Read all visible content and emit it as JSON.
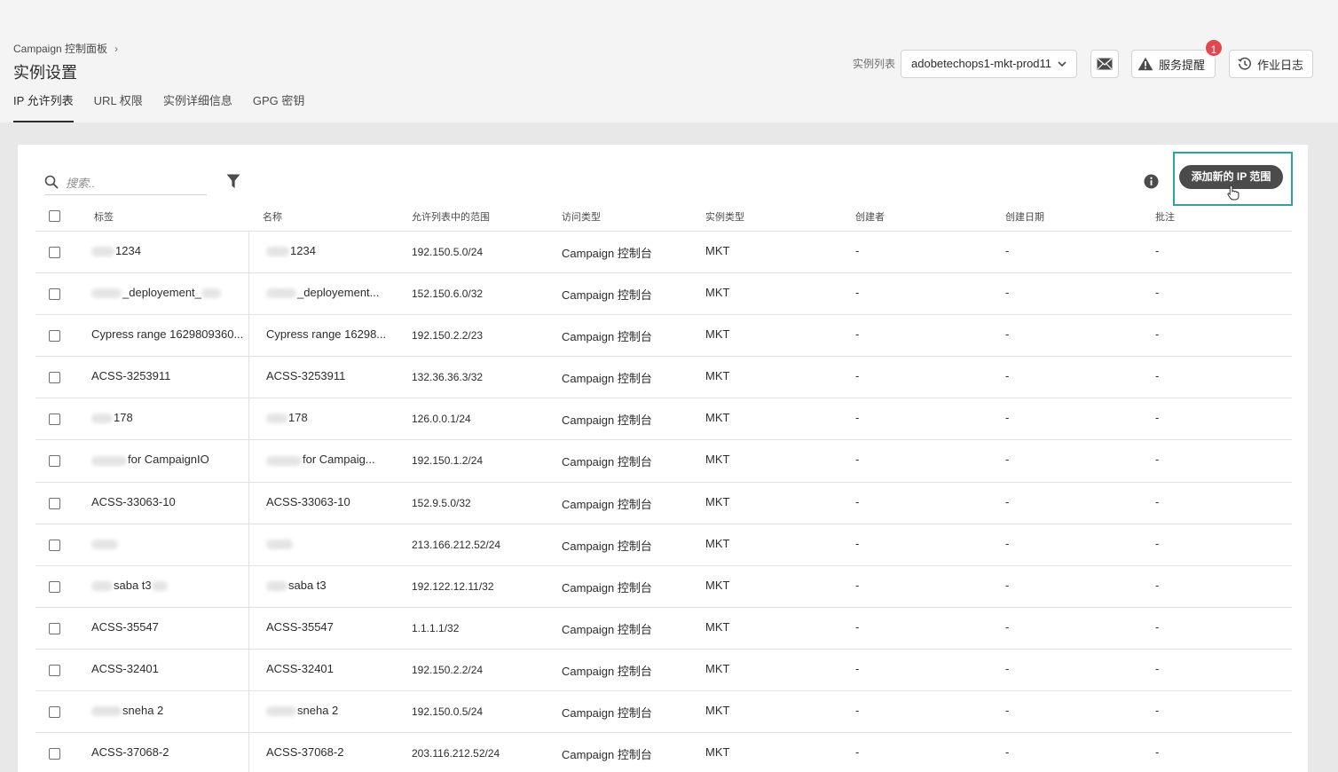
{
  "header": {
    "breadcrumb": "Campaign 控制面板",
    "title": "实例设置",
    "tabs": [
      "IP 允许列表",
      "URL 权限",
      "实例详细信息",
      "GPG 密钥"
    ],
    "instance_label": "实例列表",
    "instance_value": "adobetechops1-mkt-prod11",
    "alert_label": "服务提醒",
    "alert_badge": "1",
    "log_label": "作业日志"
  },
  "toolbar": {
    "search_placeholder": "搜索..",
    "add_button": "添加新的 IP 范围"
  },
  "table": {
    "columns": [
      "标签",
      "名称",
      "允许列表中的范围",
      "访问类型",
      "实例类型",
      "创建者",
      "创建日期",
      "批注"
    ],
    "rows": [
      {
        "label": "1234",
        "label_redacted": true,
        "name": "1234",
        "name_redacted": true,
        "range": "192.150.5.0/24",
        "access": "Campaign 控制台",
        "type": "MKT",
        "creator": "-",
        "date": "-",
        "note": "-"
      },
      {
        "label": "_deployement_",
        "label_redacted": true,
        "name": "_deployement...",
        "name_redacted": true,
        "range": "152.150.6.0/32",
        "access": "Campaign 控制台",
        "type": "MKT",
        "creator": "-",
        "date": "-",
        "note": "-"
      },
      {
        "label": "Cypress range 1629809360...",
        "label_redacted": false,
        "name": "Cypress range 16298...",
        "name_redacted": false,
        "range": "192.150.2.2/23",
        "access": "Campaign 控制台",
        "type": "MKT",
        "creator": "-",
        "date": "-",
        "note": "-"
      },
      {
        "label": "ACSS-3253911",
        "label_redacted": false,
        "name": "ACSS-3253911",
        "name_redacted": false,
        "range": "132.36.36.3/32",
        "access": "Campaign 控制台",
        "type": "MKT",
        "creator": "-",
        "date": "-",
        "note": "-"
      },
      {
        "label": "178",
        "label_redacted": true,
        "name": "178",
        "name_redacted": true,
        "range": "126.0.0.1/24",
        "access": "Campaign 控制台",
        "type": "MKT",
        "creator": "-",
        "date": "-",
        "note": "-"
      },
      {
        "label": "for CampaignIO",
        "label_redacted": true,
        "name": "for Campaig...",
        "name_redacted": true,
        "range": "192.150.1.2/24",
        "access": "Campaign 控制台",
        "type": "MKT",
        "creator": "-",
        "date": "-",
        "note": "-"
      },
      {
        "label": "ACSS-33063-10",
        "label_redacted": false,
        "name": "ACSS-33063-10",
        "name_redacted": false,
        "range": "152.9.5.0/32",
        "access": "Campaign 控制台",
        "type": "MKT",
        "creator": "-",
        "date": "-",
        "note": "-"
      },
      {
        "label": "",
        "label_redacted": true,
        "name": "",
        "name_redacted": true,
        "range": "213.166.212.52/24",
        "access": "Campaign 控制台",
        "type": "MKT",
        "creator": "-",
        "date": "-",
        "note": "-"
      },
      {
        "label": "saba t3",
        "label_redacted": true,
        "name": "saba t3",
        "name_redacted": true,
        "range": "192.122.12.11/32",
        "access": "Campaign 控制台",
        "type": "MKT",
        "creator": "-",
        "date": "-",
        "note": "-"
      },
      {
        "label": "ACSS-35547",
        "label_redacted": false,
        "name": "ACSS-35547",
        "name_redacted": false,
        "range": "1.1.1.1/32",
        "access": "Campaign 控制台",
        "type": "MKT",
        "creator": "-",
        "date": "-",
        "note": "-"
      },
      {
        "label": "ACSS-32401",
        "label_redacted": false,
        "name": "ACSS-32401",
        "name_redacted": false,
        "range": "192.150.2.2/24",
        "access": "Campaign 控制台",
        "type": "MKT",
        "creator": "-",
        "date": "-",
        "note": "-"
      },
      {
        "label": "sneha 2",
        "label_redacted": true,
        "name": "sneha 2",
        "name_redacted": true,
        "range": "192.150.0.5/24",
        "access": "Campaign 控制台",
        "type": "MKT",
        "creator": "-",
        "date": "-",
        "note": "-"
      },
      {
        "label": "ACSS-37068-2",
        "label_redacted": false,
        "name": "ACSS-37068-2",
        "name_redacted": false,
        "range": "203.116.212.52/24",
        "access": "Campaign 控制台",
        "type": "MKT",
        "creator": "-",
        "date": "-",
        "note": "-"
      }
    ]
  },
  "colors": {
    "accent_outline": "#2aa59a",
    "badge": "#e34850",
    "button_dark": "#4b4b4b"
  }
}
